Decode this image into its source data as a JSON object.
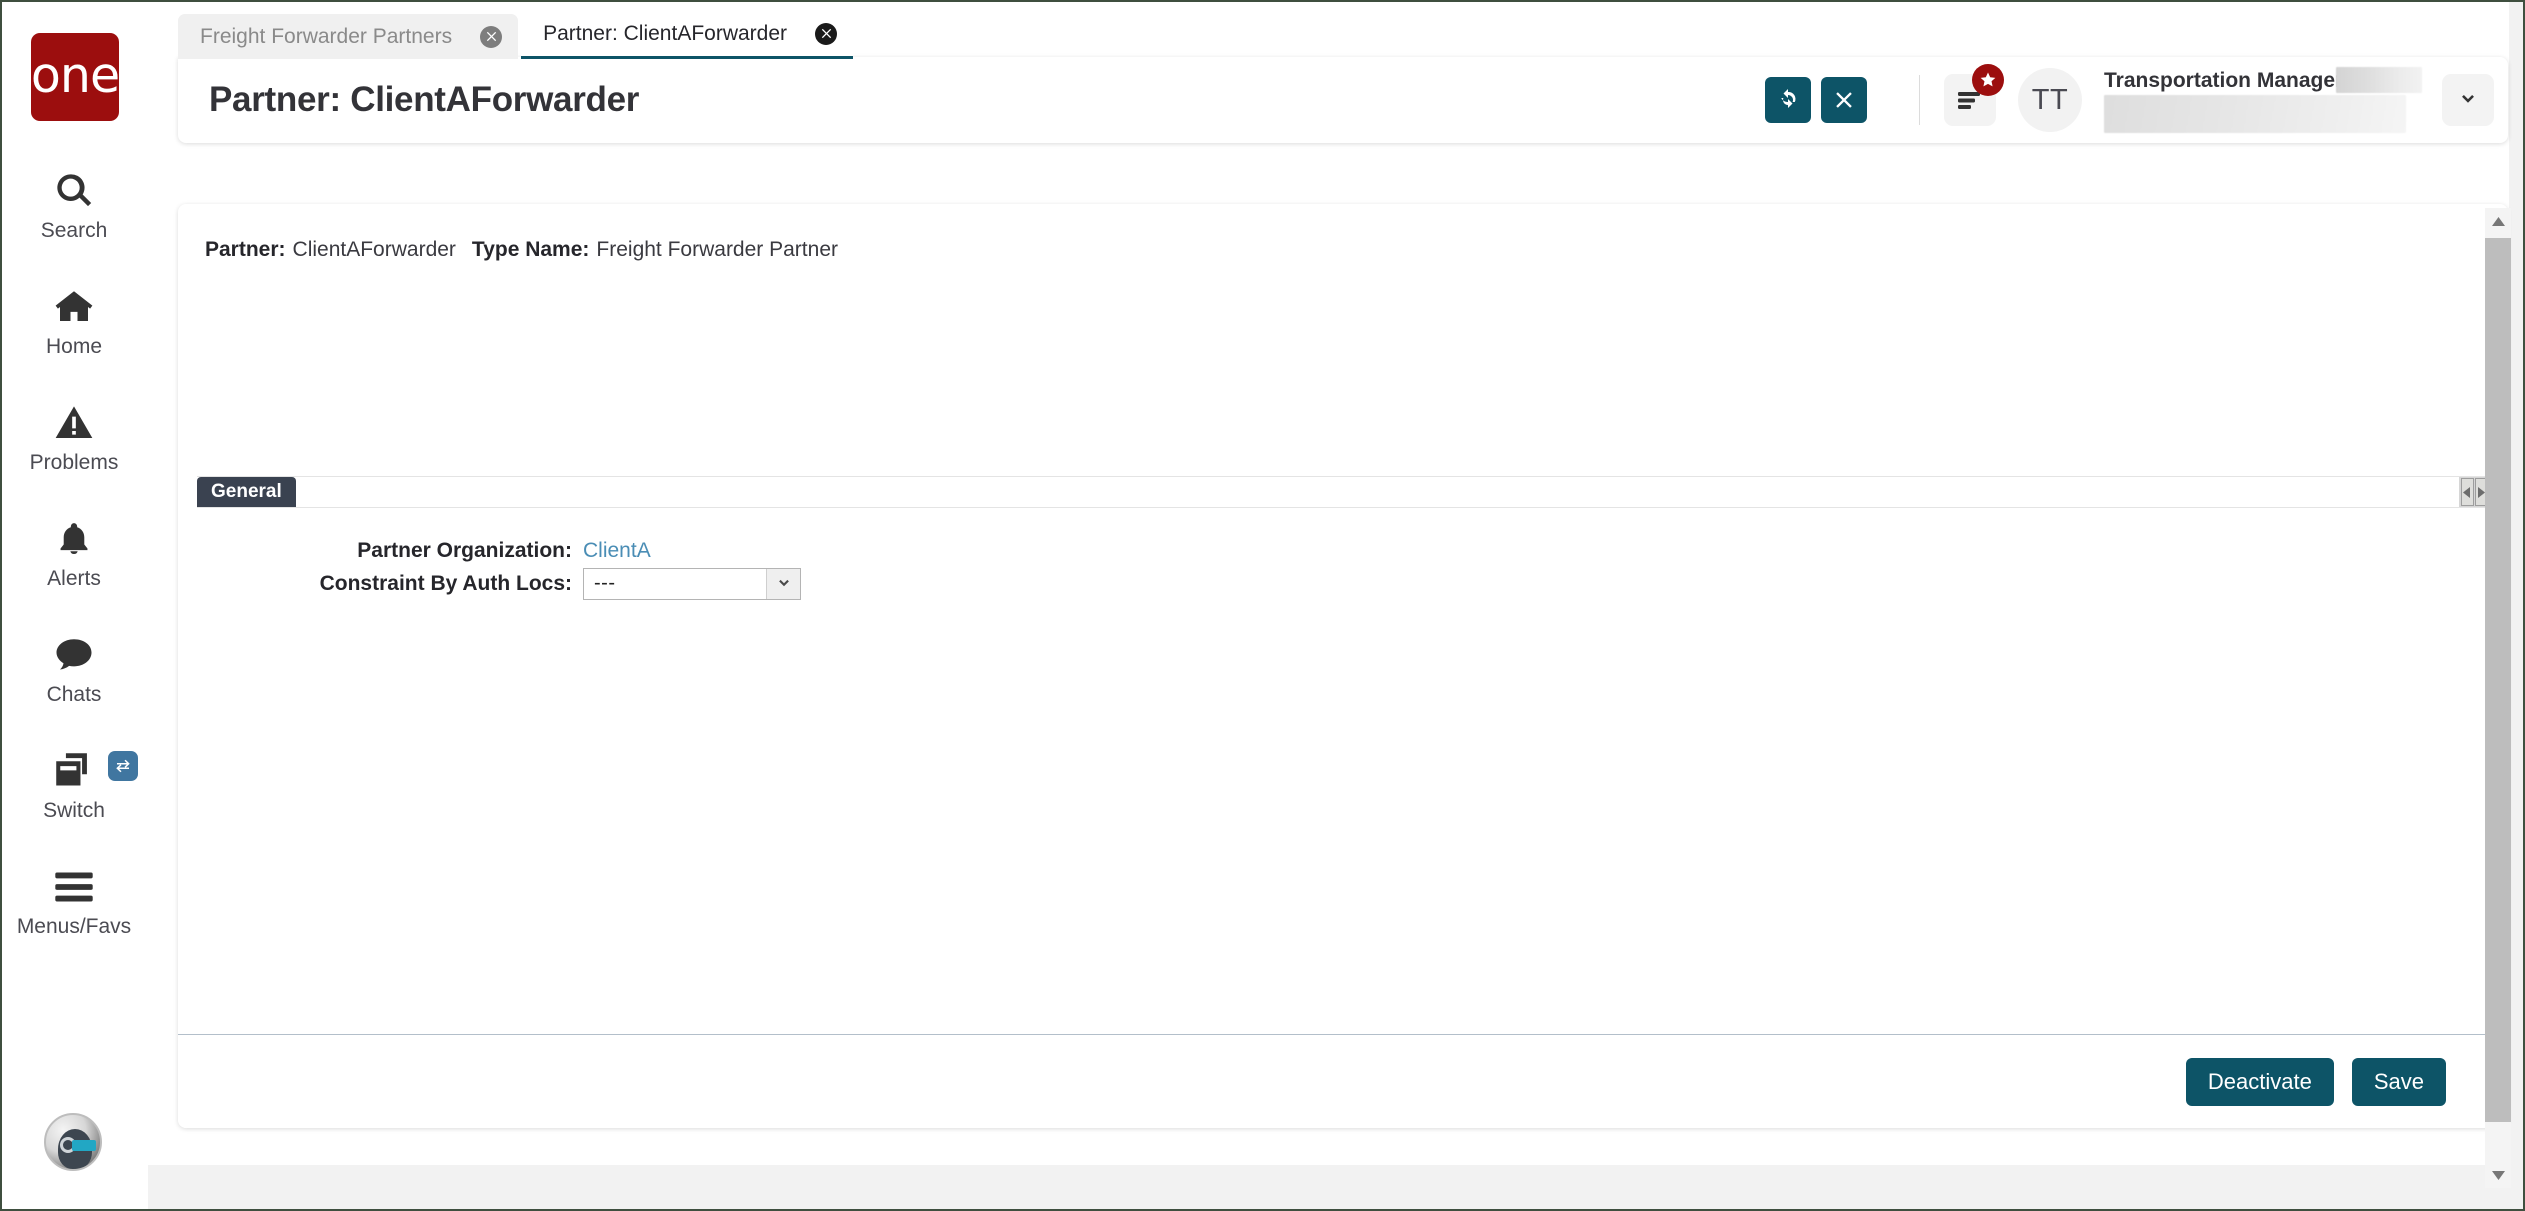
{
  "brand": {
    "logo_text": "one",
    "logo_color": "#9c0e0e"
  },
  "theme": {
    "accent_teal": "#0d5467",
    "section_tab_bg": "#3a4250",
    "link_blue": "#4a8db5",
    "badge_blue": "#4076a0",
    "badge_red": "#9c0e0e"
  },
  "sidebar": {
    "items": [
      {
        "label": "Search",
        "icon": "search-icon"
      },
      {
        "label": "Home",
        "icon": "home-icon"
      },
      {
        "label": "Problems",
        "icon": "warning-triangle-icon"
      },
      {
        "label": "Alerts",
        "icon": "bell-icon"
      },
      {
        "label": "Chats",
        "icon": "chat-bubble-icon"
      },
      {
        "label": "Switch",
        "icon": "windows-copy-icon",
        "badge_icon": "swap-arrows-icon"
      },
      {
        "label": "Menus/Favs",
        "icon": "hamburger-icon"
      }
    ],
    "avatar_name": "user-avatar"
  },
  "tabs": [
    {
      "label": "Freight Forwarder Partners",
      "active": false,
      "close_icon": "close-circle-icon"
    },
    {
      "label": "Partner: ClientAForwarder",
      "active": true,
      "close_icon": "close-circle-icon"
    }
  ],
  "header": {
    "title": "Partner: ClientAForwarder",
    "refresh_icon": "refresh-icon",
    "close_icon": "close-x-icon",
    "notifications_icon": "menu-list-icon",
    "notifications_badge_icon": "star-icon",
    "avatar_initials": "TT",
    "user_role": "Transportation Manager",
    "user_name_redacted": "",
    "user_detail_redacted": "",
    "caret_icon": "chevron-down-icon"
  },
  "summary": {
    "partner_label": "Partner:",
    "partner_value": "ClientAForwarder",
    "type_label": "Type Name:",
    "type_value": "Freight Forwarder Partner"
  },
  "section": {
    "tab_label": "General",
    "scroll_left_icon": "triangle-left-icon",
    "scroll_right_icon": "triangle-right-icon"
  },
  "form": {
    "partner_org": {
      "label": "Partner Organization:",
      "value": "ClientA"
    },
    "constraint_by_auth_locs": {
      "label": "Constraint By Auth Locs:",
      "value": "---",
      "options": [
        "---"
      ],
      "arrow_icon": "chevron-down-icon"
    }
  },
  "footer": {
    "deactivate_label": "Deactivate",
    "save_label": "Save"
  },
  "scrollbar": {
    "up_icon": "triangle-up-icon",
    "down_icon": "triangle-down-icon"
  }
}
